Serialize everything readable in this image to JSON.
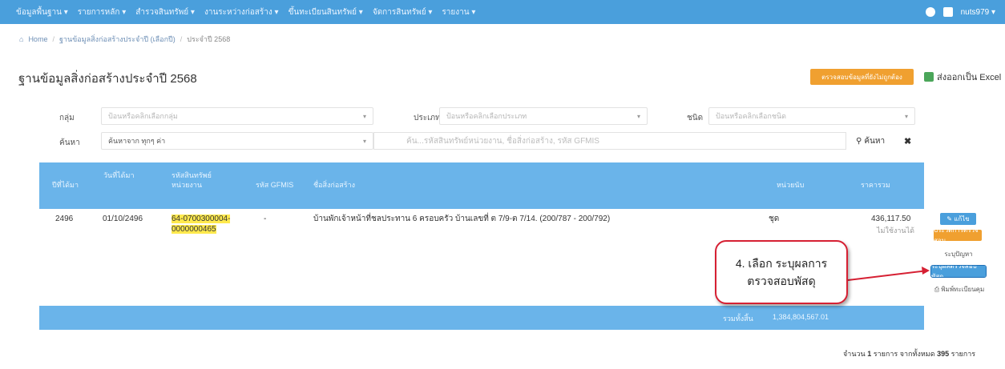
{
  "navbar": {
    "items": [
      "ข้อมูลพื้นฐาน ▾",
      "รายการหลัก ▾",
      "สำรวจสินทรัพย์ ▾",
      "งานระหว่างก่อสร้าง ▾",
      "ขึ้นทะเบียนสินทรัพย์ ▾",
      "จัดการสินทรัพย์ ▾",
      "รายงาน ▾"
    ],
    "username": "nuts979 ▾"
  },
  "breadcrumb": {
    "home": "Home",
    "parent": "ฐานข้อมูลสิ่งก่อสร้างประจำปี (เลือกปี)",
    "current": "ประจำปี 2568"
  },
  "page": {
    "title": "ฐานข้อมูลสิ่งก่อสร้างประจำปี 2568",
    "orange_button": "ตรวจสอบข้อมูลที่ยังไม่ถูกต้อง",
    "excel_button": "ส่งออกเป็น Excel"
  },
  "filters": {
    "group_label": "กลุ่ม",
    "group_placeholder": "ป้อนหรือคลิกเลือกกลุ่ม",
    "type_label": "ประเภท",
    "type_placeholder": "ป้อนหรือคลิกเลือกประเภท",
    "kind_label": "ชนิด",
    "kind_placeholder": "ป้อนหรือคลิกเลือกชนิด",
    "search_label": "ค้นหา",
    "search_scope": "ค้นหาจาก ทุกๆ ค่า",
    "search_placeholder": "ค้น...รหัสสินทรัพย์หน่วยงาน, ชื่อสิ่งก่อสร้าง, รหัส GFMIS",
    "search_button": "ค้นหา",
    "clear_button": "✖"
  },
  "table": {
    "headers": [
      "ปีที่ได้มา",
      "วันที่ได้มา",
      "รหัสสินทรัพย์หน่วยงาน",
      "รหัส GFMIS",
      "ชื่อสิ่งก่อสร้าง",
      "หน่วยนับ",
      "ราคารวม"
    ],
    "row": {
      "year": "2496",
      "date": "01/10/2496",
      "asset_code_1": "64-0700300004-",
      "asset_code_2": "0000000465",
      "gfmis": "-",
      "name": "บ้านพักเจ้าหน้าที่ชลประทาน 6 ครอบครัว บ้านเลขที่ ต 7/9-ต 7/14. (200/787 - 200/792)",
      "unit": "ชุด",
      "price": "436,117.50",
      "status": "ไม่ใช้งานได้"
    },
    "footer_label": "รวมทั้งสิ้น",
    "footer_total": "1,384,804,567.01"
  },
  "actions": {
    "edit": "✎ แก้ไข",
    "check": "ประวัติการตรวจสอบ",
    "problem": "ระบุปัญหา",
    "result": "ระบุผลตรวจสอบพัสดุ",
    "print": "⎙ พิมพ์ทะเบียนคุม"
  },
  "callout": {
    "line1": "4. เลือก ระบุผลการ",
    "line2": "ตรวจสอบพัสดุ"
  },
  "footer": {
    "prefix": "จำนวน",
    "count": "1",
    "middle": "รายการ จากทั้งหมด",
    "total": "395",
    "suffix": "รายการ"
  },
  "colors": {
    "navbar": "#4a9fdc",
    "table_header": "#6ab4ea",
    "accent_orange": "#f0a030",
    "callout_border": "#d62033"
  }
}
